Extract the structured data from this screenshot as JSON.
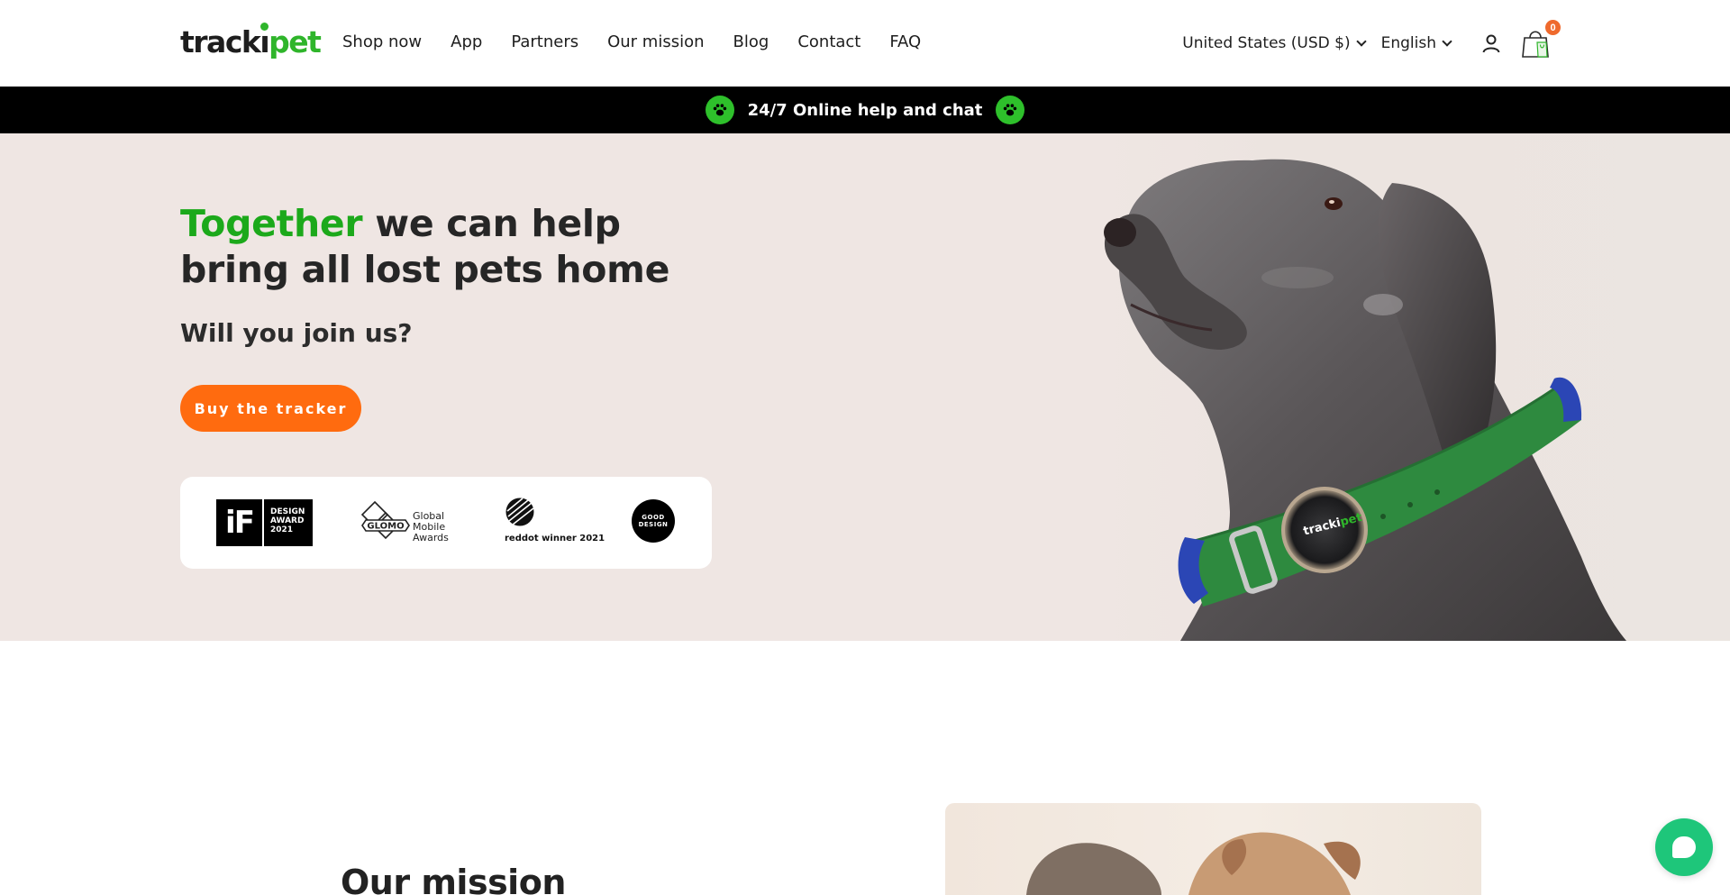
{
  "header": {
    "logo": {
      "text_a": "tracki",
      "text_b": "pet"
    },
    "nav": [
      "Shop now",
      "App",
      "Partners",
      "Our mission",
      "Blog",
      "Contact",
      "FAQ"
    ],
    "currency_selector": "United States (USD $)",
    "language_selector": "English",
    "account_icon": "user-icon",
    "cart": {
      "icon": "shopping-bag-icon",
      "count": "0"
    }
  },
  "announcement": {
    "text": "24/7 Online help and chat",
    "icon": "paw-icon",
    "accent_color": "#2ec02b"
  },
  "hero": {
    "title_highlight": "Together",
    "title_rest": " we can help bring all lost pets home",
    "subtitle": "Will you join us?",
    "cta_label": "Buy the tracker",
    "cta_color": "#ff6b0f",
    "highlight_color": "#1ca91b",
    "image_alt": "dog-with-tracker-collar",
    "collar_tracker_text_a": "tracki",
    "collar_tracker_text_b": "pet",
    "awards": {
      "if": {
        "logo": "iF",
        "line1": "DESIGN",
        "line2": "AWARD",
        "line3": "2021"
      },
      "glomo": {
        "logo": "GLOMO",
        "line1": "Global",
        "line2": "Mobile",
        "line3": "Awards"
      },
      "reddot": {
        "label": "reddot winner 2021"
      },
      "good_design": {
        "line1": "GOOD",
        "line2": "DESIGN"
      }
    }
  },
  "mission": {
    "title": "Our mission"
  },
  "chat": {
    "icon": "chat-bubble-icon",
    "color": "#1ec67a"
  }
}
